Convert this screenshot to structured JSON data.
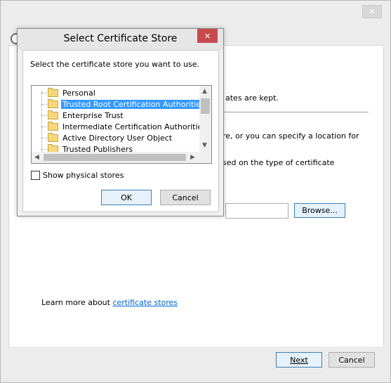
{
  "wizard": {
    "partial_text": {
      "line1": "ates are kept.",
      "line2": "re, or you can specify a location for",
      "line3": "sed on the type of certificate"
    },
    "browse_label": "Browse...",
    "learn_prefix": "Learn more about ",
    "learn_link": "certificate stores",
    "next_label": "Next",
    "cancel_label": "Cancel"
  },
  "dialog": {
    "title": "Select Certificate Store",
    "instruction": "Select the certificate store you want to use.",
    "tree_items": [
      {
        "label": "Personal",
        "selected": false
      },
      {
        "label": "Trusted Root Certification Authorities",
        "selected": true
      },
      {
        "label": "Enterprise Trust",
        "selected": false
      },
      {
        "label": "Intermediate Certification Authorities",
        "selected": false
      },
      {
        "label": "Active Directory User Object",
        "selected": false
      },
      {
        "label": "Trusted Publishers",
        "selected": false
      }
    ],
    "show_physical_label": "Show physical stores",
    "show_physical_checked": false,
    "ok_label": "OK",
    "cancel_label": "Cancel"
  },
  "icons": {
    "close": "close-icon",
    "folder": "folder-icon",
    "back": "back-arrow-icon"
  },
  "colors": {
    "selection": "#3399ff",
    "dialog_close": "#c74b4b",
    "link": "#0066cc"
  }
}
